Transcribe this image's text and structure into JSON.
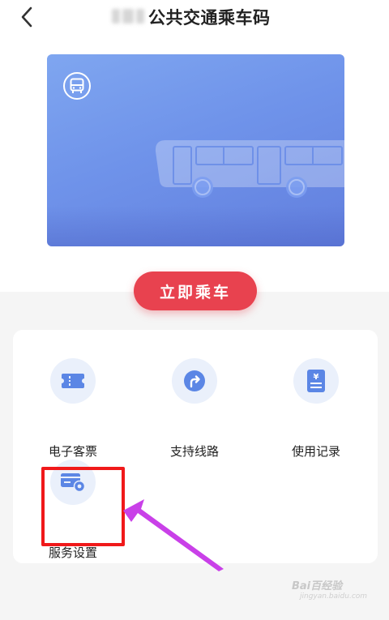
{
  "header": {
    "title": "公共交通乘车码",
    "back_icon": "chevron-left-icon"
  },
  "card": {
    "badge_icon": "bus-icon",
    "illustration": "bus-illustration",
    "gradient_start": "#7fa6f0",
    "gradient_end": "#627fde"
  },
  "ride_button": {
    "label": "立即乘车",
    "color": "#e8424f"
  },
  "menu": {
    "items": [
      {
        "label": "电子客票",
        "icon": "ticket-icon"
      },
      {
        "label": "支持线路",
        "icon": "route-icon"
      },
      {
        "label": "使用记录",
        "icon": "receipt-icon"
      },
      {
        "label": "服务设置",
        "icon": "card-settings-icon"
      }
    ]
  },
  "annotation": {
    "highlight_color": "#f0191a",
    "arrow_color": "#c940e8"
  },
  "watermark": {
    "brand": "Bai百经验",
    "url": "jingyan.baidu.com"
  }
}
